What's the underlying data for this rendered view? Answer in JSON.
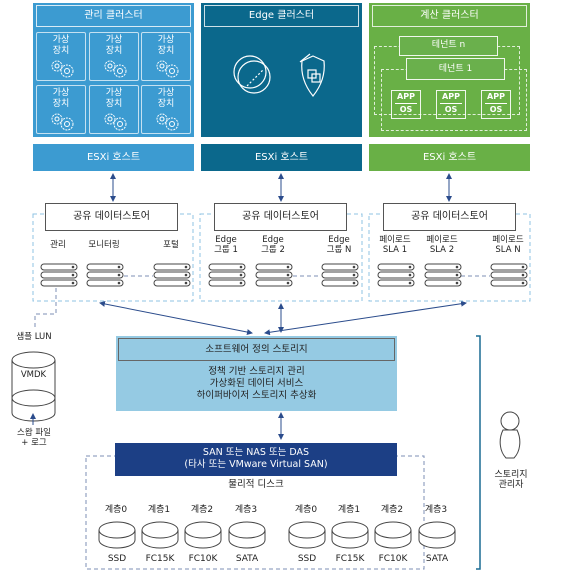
{
  "clusters": [
    {
      "title": "관리 클러스터",
      "color": "#3c9bd1",
      "vm_label": "가상\n장치",
      "esxi": "ESXi 호스트",
      "datastore": "공유 데이터스토어",
      "items": [
        "관리",
        "모니터링",
        "포털"
      ]
    },
    {
      "title": "Edge 클러스터",
      "color": "#0b688c",
      "esxi": "ESXi 호스트",
      "datastore": "공유 데이터스토어",
      "items": [
        "Edge\n그룹 1",
        "Edge\n그룹 2",
        "Edge\n그룹 N"
      ]
    },
    {
      "title": "계산 클러스터",
      "color": "#69b046",
      "tenants": [
        "테넌트 n",
        "테넌트 1"
      ],
      "app": "APP",
      "os": "OS",
      "esxi": "ESXi 호스트",
      "datastore": "공유 데이터스토어",
      "items": [
        "페이로드\nSLA 1",
        "페이로드\nSLA 2",
        "페이로드\nSLA N"
      ]
    }
  ],
  "lun": {
    "title": "샘플 LUN",
    "vmdk": "VMDK",
    "swap": "스왑 파일\n+ 로그"
  },
  "sds": {
    "title": "소프트웨어 정의 스토리지",
    "lines": [
      "정책 기반 스토리지 관리",
      "가상화된 데이터 서비스",
      "하이퍼바이저 스토리지 추상화"
    ],
    "color": "#95cae3"
  },
  "san": {
    "line1": "SAN 또는 NAS 또는 DAS",
    "line2": "(타사 또는 VMware Virtual SAN)",
    "color": "#1c3f85"
  },
  "physical": {
    "title": "물리적 디스크",
    "tiers": [
      "계층0",
      "계층1",
      "계층2",
      "계층3",
      "계층0",
      "계층1",
      "계층2",
      "계층3"
    ],
    "types": [
      "SSD",
      "FC15K",
      "FC10K",
      "SATA",
      "SSD",
      "FC15K",
      "FC10K",
      "SATA"
    ]
  },
  "admin": {
    "label": "스토리지\n관리자"
  }
}
